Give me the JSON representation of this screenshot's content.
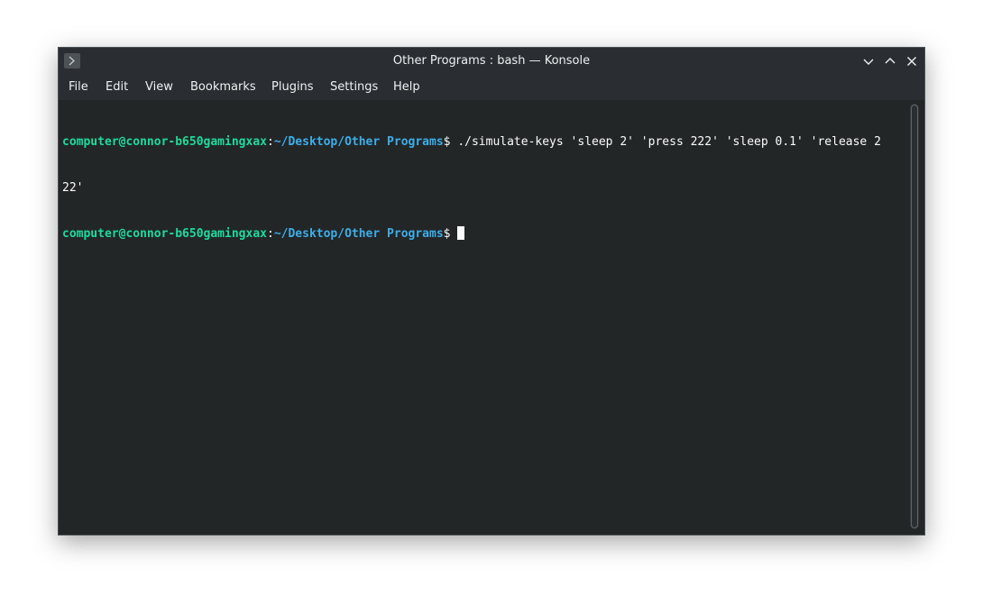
{
  "window": {
    "title": "Other Programs : bash — Konsole",
    "app_icon": "terminal-prompt-icon",
    "controls": [
      "minimize-icon",
      "maximize-icon",
      "close-icon"
    ]
  },
  "menubar": {
    "items": [
      "File",
      "Edit",
      "View",
      "Bookmarks",
      "Plugins",
      "Settings",
      "Help"
    ]
  },
  "terminal": {
    "lines": [
      {
        "user_host": "computer@connor-b650gamingxax",
        "sep": ":",
        "path": "~/Desktop/Other Programs",
        "prompt": "$ ",
        "command": "./simulate-keys 'sleep 2' 'press 222' 'sleep 0.1' 'release 2"
      },
      {
        "wrap": "22'"
      },
      {
        "user_host": "computer@connor-b650gamingxax",
        "sep": ":",
        "path": "~/Desktop/Other Programs",
        "prompt": "$ ",
        "command": ""
      }
    ]
  },
  "colors": {
    "background": "#232627",
    "user_host": "#1cdc9a",
    "path": "#3daee9",
    "text": "#fcfcfc"
  }
}
